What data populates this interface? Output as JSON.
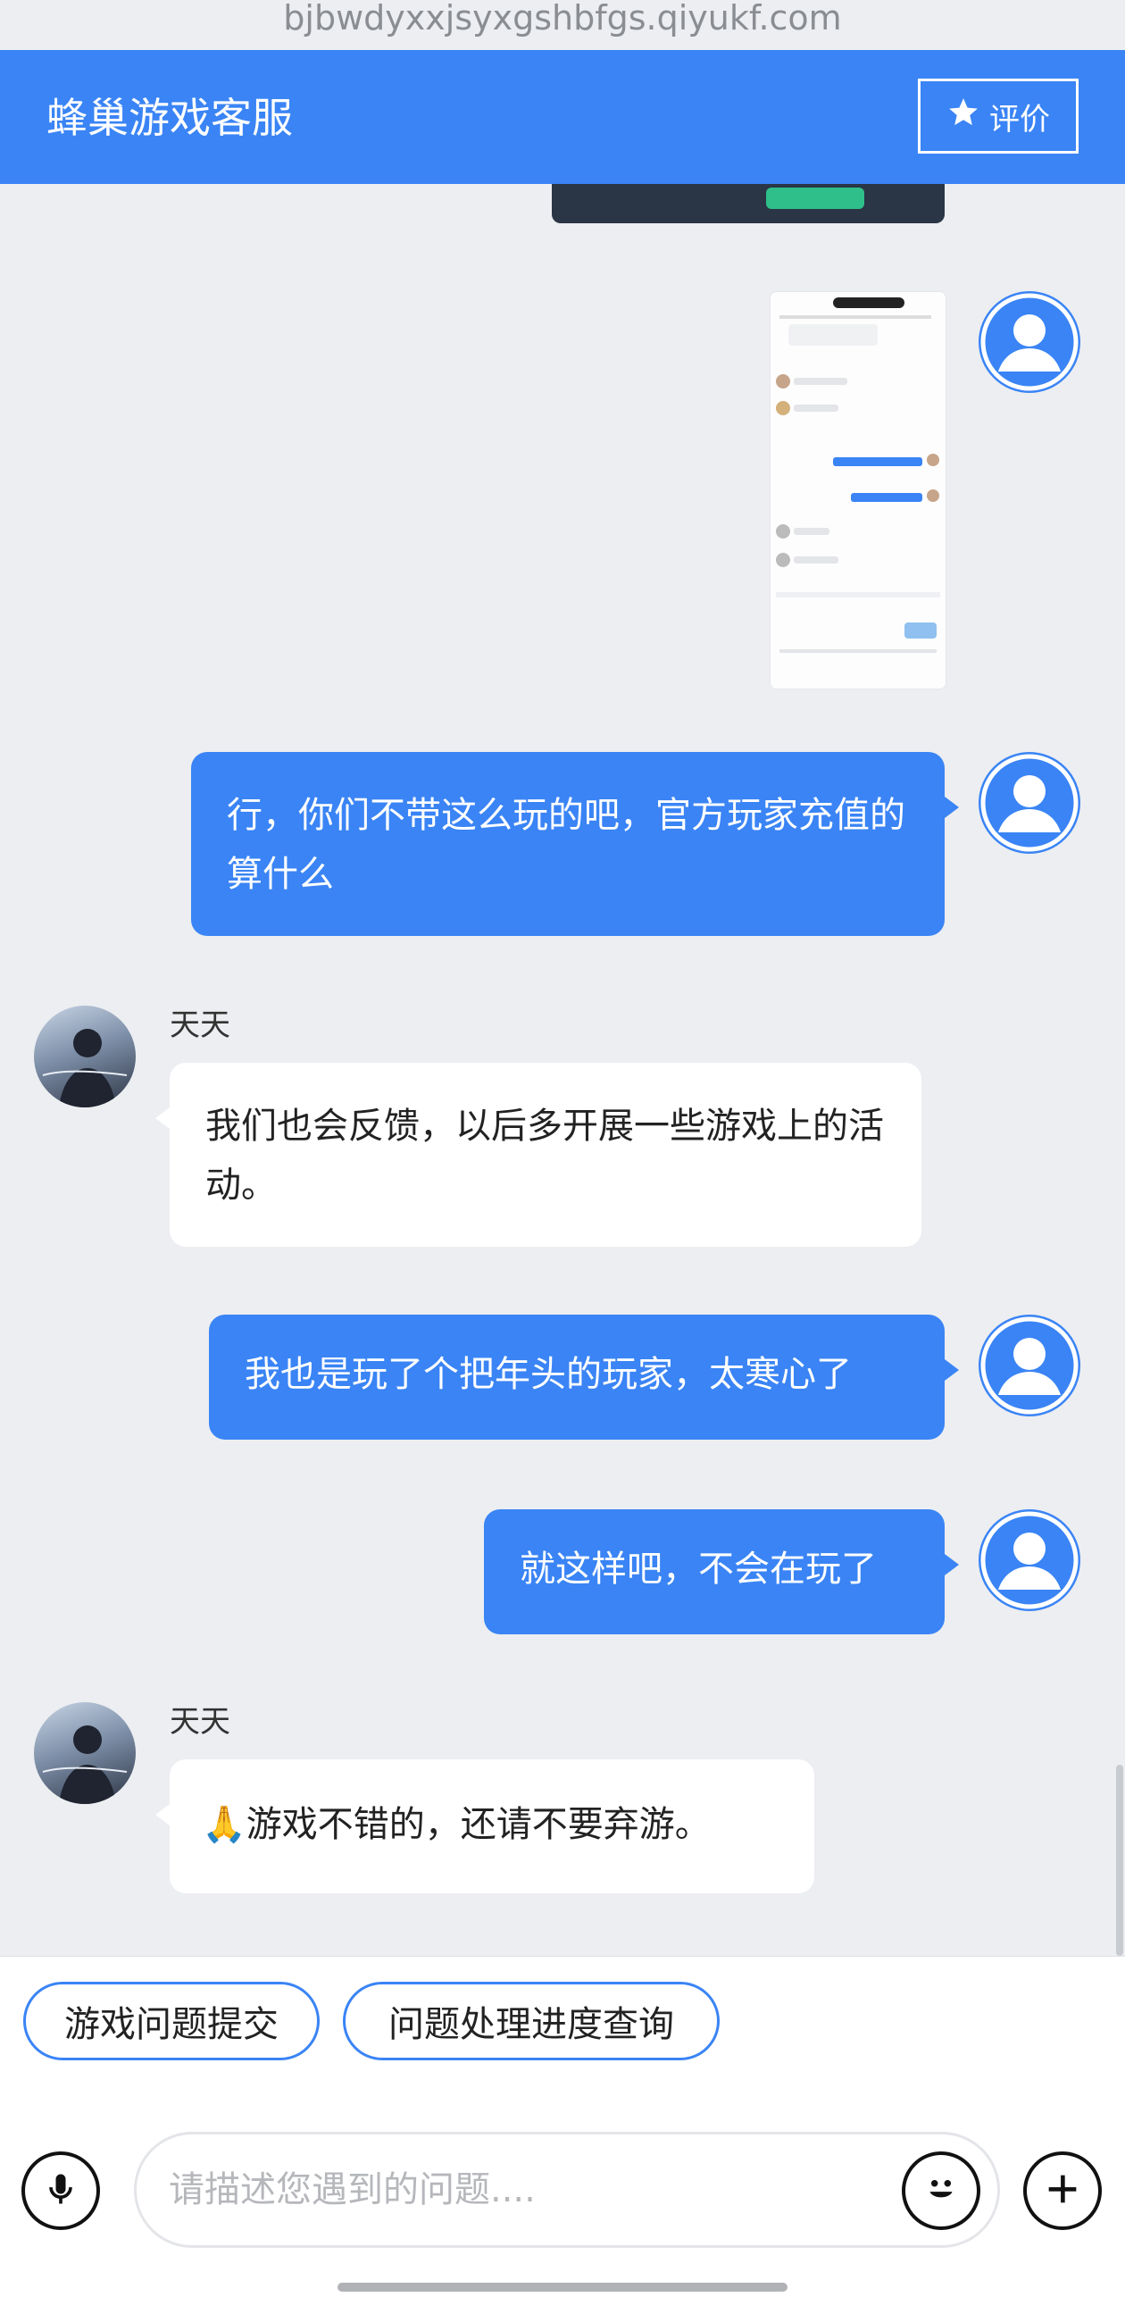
{
  "browser": {
    "url": "bjbwdyxxjsyxgshbfgs.qiyukf.com"
  },
  "header": {
    "title": "蜂巢游戏客服",
    "rate_label": "评价"
  },
  "messages": [
    {
      "from": "user",
      "type": "image"
    },
    {
      "from": "user",
      "type": "text",
      "text": "行，你们不带这么玩的吧，官方玩家充值的算什么"
    },
    {
      "from": "agent",
      "name": "天天",
      "type": "text",
      "text": "我们也会反馈，以后多开展一些游戏上的活动。"
    },
    {
      "from": "user",
      "type": "text",
      "text": "我也是玩了个把年头的玩家，太寒心了"
    },
    {
      "from": "user",
      "type": "text",
      "text": "就这样吧，不会在玩了"
    },
    {
      "from": "agent",
      "name": "天天",
      "type": "text",
      "text": "🙏游戏不错的，还请不要弃游。"
    }
  ],
  "quick_actions": [
    "游戏问题提交",
    "问题处理进度查询"
  ],
  "composer": {
    "placeholder": "请描述您遇到的问题...."
  },
  "colors": {
    "brand": "#3a84f5",
    "background": "#eceef1"
  },
  "icons": {
    "rate": "star-icon",
    "voice": "microphone-icon",
    "emoji": "emoji-icon",
    "more": "plus-icon"
  }
}
